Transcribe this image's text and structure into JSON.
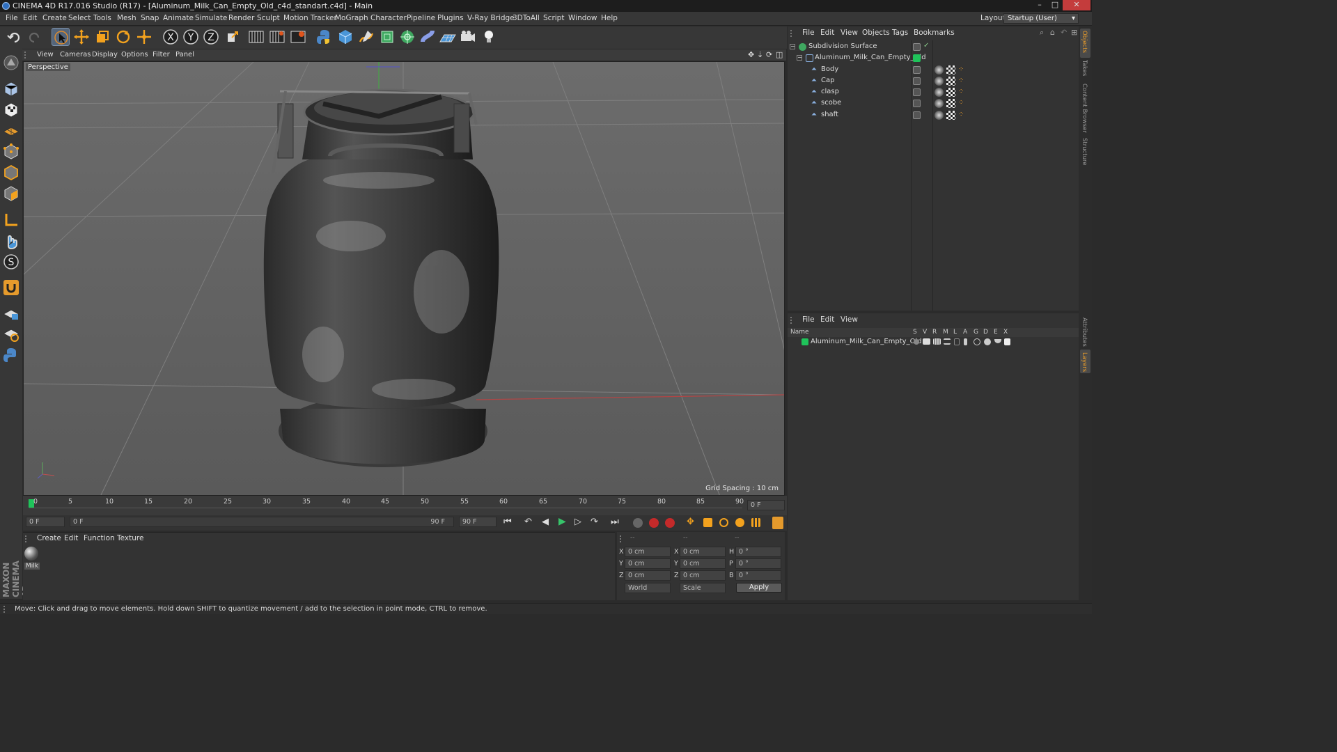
{
  "window": {
    "title": "CINEMA 4D R17.016 Studio (R17) - [Aluminum_Milk_Can_Empty_Old_c4d_standart.c4d] - Main",
    "controls": [
      "–",
      "□",
      "✕"
    ]
  },
  "menubar": {
    "items": [
      "File",
      "Edit",
      "Create",
      "Select",
      "Tools",
      "Mesh",
      "Snap",
      "Animate",
      "Simulate",
      "Render",
      "Sculpt",
      "Motion Tracker",
      "MoGraph",
      "Character",
      "Pipeline",
      "Plugins",
      "V-Ray Bridge",
      "3DToAll",
      "Script",
      "Window",
      "Help"
    ],
    "layout_label": "Layout:",
    "layout_value": "Startup (User)"
  },
  "toolbar": {
    "axis_x": "X",
    "axis_y": "Y",
    "axis_z": "Z"
  },
  "viewport": {
    "menu": [
      "View",
      "Cameras",
      "Display",
      "Options",
      "Filter",
      "Panel"
    ],
    "label": "Perspective",
    "grid_spacing": "Grid Spacing : 10 cm",
    "colors": {
      "bg_top": "#6c6c6c",
      "bg_bottom": "#5a5a5a",
      "grid": "#808080",
      "axis_x": "#b04040",
      "axis_y": "#40b040"
    }
  },
  "timeline": {
    "ticks": [
      "0",
      "5",
      "10",
      "15",
      "20",
      "25",
      "30",
      "35",
      "40",
      "45",
      "50",
      "55",
      "60",
      "65",
      "70",
      "75",
      "80",
      "85",
      "90"
    ],
    "current_frame_field": "0 F",
    "start_field": "0 F",
    "range_start": "0 F",
    "range_end": "90 F",
    "end_field": "90 F"
  },
  "material_manager": {
    "menu": [
      "Create",
      "Edit",
      "Function",
      "Texture"
    ],
    "materials": [
      {
        "label": "Milk"
      }
    ]
  },
  "coordinates": {
    "header": [
      "--",
      "--",
      "--"
    ],
    "rows": [
      {
        "a": "X",
        "av": "0 cm",
        "b": "X",
        "bv": "0 cm",
        "c": "H",
        "cv": "0 °"
      },
      {
        "a": "Y",
        "av": "0 cm",
        "b": "Y",
        "bv": "0 cm",
        "c": "P",
        "cv": "0 °"
      },
      {
        "a": "Z",
        "av": "0 cm",
        "b": "Z",
        "bv": "0 cm",
        "c": "B",
        "cv": "0 °"
      }
    ],
    "mode": "World",
    "scale_mode": "Scale",
    "apply": "Apply"
  },
  "object_manager": {
    "menu": [
      "File",
      "Edit",
      "View",
      "Objects",
      "Tags",
      "Bookmarks"
    ],
    "objects": [
      {
        "name": "Subdivision Surface",
        "depth": 0
      },
      {
        "name": "Aluminum_Milk_Can_Empty_Old",
        "depth": 1
      },
      {
        "name": "Body",
        "depth": 2
      },
      {
        "name": "Cap",
        "depth": 2
      },
      {
        "name": "clasp",
        "depth": 2
      },
      {
        "name": "scobe",
        "depth": 2
      },
      {
        "name": "shaft",
        "depth": 2
      }
    ]
  },
  "layer_manager": {
    "menu": [
      "File",
      "Edit",
      "View"
    ],
    "columns": [
      "Name",
      "S",
      "V",
      "R",
      "M",
      "L",
      "A",
      "G",
      "D",
      "E",
      "X"
    ],
    "layers": [
      {
        "name": "Aluminum_Milk_Can_Empty_Old",
        "color": "#1fc35a"
      }
    ]
  },
  "side_tabs": [
    "Objects",
    "Takes",
    "Content Browser",
    "Structure",
    "Attributes",
    "Layers"
  ],
  "branding": "MAXON CINEMA 4D",
  "status": "Move: Click and drag to move elements. Hold down SHIFT to quantize movement / add to the selection in point mode, CTRL to remove."
}
